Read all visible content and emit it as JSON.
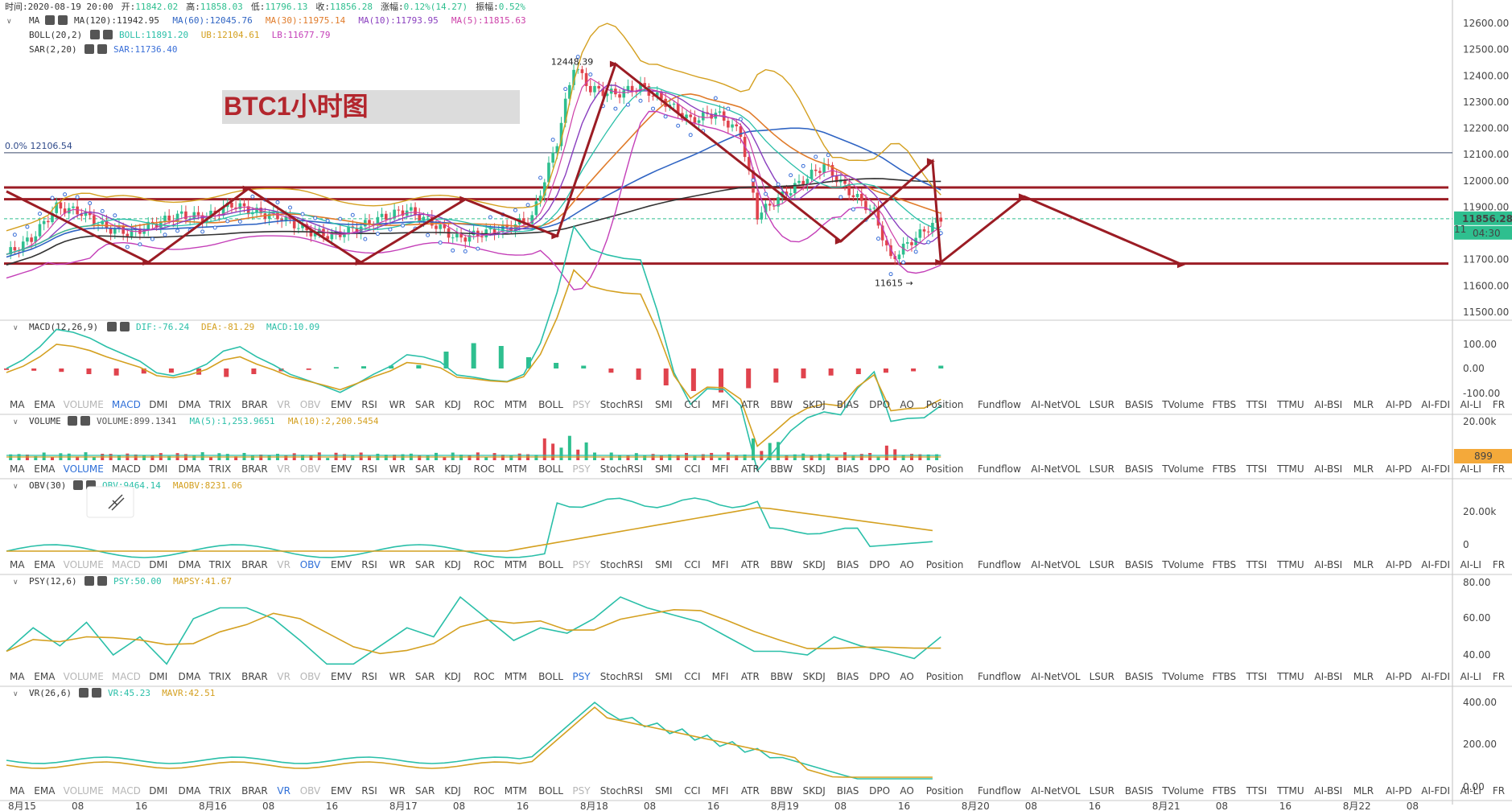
{
  "header": {
    "time_label": "时间:",
    "time": "2020-08-19 20:00",
    "open_label": "开:",
    "open": "11842.02",
    "high_label": "高:",
    "high": "11858.03",
    "low_label": "低:",
    "low": "11796.13",
    "close_label": "收:",
    "close": "11856.28",
    "change_label": "涨幅:",
    "change": "0.12%(14.27)",
    "amp_label": "振幅:",
    "amp": "0.52%"
  },
  "overlay_title": "BTC1小时图",
  "colors": {
    "bull": "#2ebf8f",
    "bear": "#e0434d",
    "annot": "#9b1c24",
    "ma120": "#333333",
    "ma60": "#2f64c3",
    "ma30": "#e07b2a",
    "ma10": "#8a3fbf",
    "ma5": "#cc3fa8",
    "boll": "#2abfa8",
    "ub": "#d4a020",
    "lb": "#c43fb8",
    "sar": "#3a6fd8"
  },
  "indicators": {
    "ma": {
      "name": "MA",
      "values": [
        {
          "label": "MA(120):11942.95",
          "color": "#333333"
        },
        {
          "label": "MA(60):12045.76",
          "color": "#2f64c3"
        },
        {
          "label": "MA(30):11975.14",
          "color": "#e07b2a"
        },
        {
          "label": "MA(10):11793.95",
          "color": "#8a3fbf"
        },
        {
          "label": "MA(5):11815.63",
          "color": "#cc3fa8"
        }
      ]
    },
    "boll": {
      "name": "BOLL(20,2)",
      "values": [
        {
          "label": "BOLL:11891.20",
          "color": "#2abfa8"
        },
        {
          "label": "UB:12104.61",
          "color": "#d4a020"
        },
        {
          "label": "LB:11677.79",
          "color": "#c43fb8"
        }
      ]
    },
    "sar": {
      "name": "SAR(2,20)",
      "values": [
        {
          "label": "SAR:11736.40",
          "color": "#3a6fd8"
        }
      ]
    }
  },
  "panels": [
    {
      "id": "macd",
      "name": "MACD(12,26,9)",
      "values": [
        {
          "label": "DIF:-76.24",
          "color": "#2abfa8"
        },
        {
          "label": "DEA:-81.29",
          "color": "#d4a020"
        },
        {
          "label": "MACD:10.09",
          "color": "#2abfa8"
        }
      ],
      "ticks": [
        "100.00",
        "0.00",
        "-100.00"
      ]
    },
    {
      "id": "volume",
      "name": "VOLUME",
      "values": [
        {
          "label": "VOLUME:899.1341",
          "color": "#555555"
        },
        {
          "label": "MA(5):1,253.9651",
          "color": "#2abfa8"
        },
        {
          "label": "MA(10):2,200.5454",
          "color": "#d4a020"
        }
      ],
      "ticks": [
        "20.00k"
      ],
      "badge": "899"
    },
    {
      "id": "obv",
      "name": "OBV(30)",
      "values": [
        {
          "label": "OBV:9464.14",
          "color": "#2abfa8"
        },
        {
          "label": "MAOBV:8231.06",
          "color": "#d4a020"
        }
      ],
      "ticks": [
        "20.00k",
        "0"
      ]
    },
    {
      "id": "psy",
      "name": "PSY(12,6)",
      "values": [
        {
          "label": "PSY:50.00",
          "color": "#2abfa8"
        },
        {
          "label": "MAPSY:41.67",
          "color": "#d4a020"
        }
      ],
      "ticks": [
        "80.00",
        "60.00",
        "40.00"
      ]
    },
    {
      "id": "vr",
      "name": "VR(26,6)",
      "values": [
        {
          "label": "VR:45.23",
          "color": "#2abfa8"
        },
        {
          "label": "MAVR:42.51",
          "color": "#d4a020"
        }
      ],
      "ticks": [
        "400.00",
        "200.00",
        "0.00"
      ]
    }
  ],
  "tab_bar": [
    "MA",
    "EMA",
    "VOLUME",
    "MACD",
    "DMI",
    "DMA",
    "TRIX",
    "BRAR",
    "VR",
    "OBV",
    "EMV",
    "RSI",
    "WR",
    "SAR",
    "KDJ",
    "ROC",
    "MTM",
    "BOLL",
    "PSY",
    "StochRSI",
    "SMI",
    "CCI",
    "MFI",
    "ATR",
    "BBW",
    "SKDJ",
    "BIAS",
    "DPO",
    "AO",
    "Position",
    "Fundflow",
    "AI-NetVOL",
    "LSUR",
    "BASIS",
    "TVolume",
    "FTBS",
    "TTSI",
    "TTMU",
    "AI-BSI",
    "MLR",
    "AI-PD",
    "AI-FDI",
    "AI-LI",
    "FR",
    "AI-BST"
  ],
  "tab_bars": [
    {
      "disabled": [
        "VOLUME",
        "VR",
        "OBV",
        "PSY"
      ],
      "active": "MACD"
    },
    {
      "disabled": [
        "VR",
        "OBV",
        "PSY"
      ],
      "active": "VOLUME"
    },
    {
      "disabled": [
        "VOLUME",
        "MACD",
        "VR",
        "PSY"
      ],
      "active": "OBV"
    },
    {
      "disabled": [
        "VOLUME",
        "MACD",
        "VR",
        "OBV"
      ],
      "active": "PSY"
    },
    {
      "disabled": [
        "VOLUME",
        "MACD",
        "OBV",
        "PSY"
      ],
      "active": "VR"
    }
  ],
  "time_axis": [
    "8月15",
    "08",
    "16",
    "8月16",
    "08",
    "16",
    "8月17",
    "08",
    "16",
    "8月18",
    "08",
    "16",
    "8月19",
    "08",
    "16",
    "8月20",
    "08",
    "16",
    "8月21",
    "08",
    "16",
    "8月22",
    "08"
  ],
  "price_axis": {
    "ticks": [
      "12600.00",
      "12500.00",
      "12400.00",
      "12300.00",
      "12200.00",
      "12100.00",
      "12000.00",
      "11900.00",
      "11800.00",
      "11700.00",
      "11600.00",
      "11500.00"
    ],
    "last_price": "11856.28",
    "countdown": "04:30",
    "hidden_value": "11"
  },
  "chart_data": {
    "type": "candlestick",
    "title": "BTC1小时图",
    "ylim": [
      11500,
      12650
    ],
    "annotations": {
      "fib_label": "0.0% 12106.54",
      "high_label": "12448.39",
      "low_label": "11615 →",
      "horizontal_levels": [
        11975,
        11930,
        11685,
        12107
      ]
    },
    "price_path": [
      {
        "t": 0,
        "o": 11700,
        "c": 11720
      },
      {
        "t": 6,
        "o": 11720,
        "c": 11780
      },
      {
        "t": 12,
        "o": 11780,
        "c": 11900
      },
      {
        "t": 18,
        "o": 11900,
        "c": 11880
      },
      {
        "t": 24,
        "o": 11880,
        "c": 11820
      },
      {
        "t": 30,
        "o": 11820,
        "c": 11800
      },
      {
        "t": 36,
        "o": 11800,
        "c": 11840
      },
      {
        "t": 42,
        "o": 11840,
        "c": 11870
      },
      {
        "t": 48,
        "o": 11870,
        "c": 11860
      },
      {
        "t": 54,
        "o": 11860,
        "c": 11910
      },
      {
        "t": 60,
        "o": 11910,
        "c": 11880
      },
      {
        "t": 66,
        "o": 11880,
        "c": 11860
      },
      {
        "t": 72,
        "o": 11860,
        "c": 11810
      },
      {
        "t": 78,
        "o": 11810,
        "c": 11790
      },
      {
        "t": 84,
        "o": 11790,
        "c": 11820
      },
      {
        "t": 90,
        "o": 11820,
        "c": 11860
      },
      {
        "t": 96,
        "o": 11860,
        "c": 11890
      },
      {
        "t": 102,
        "o": 11890,
        "c": 11840
      },
      {
        "t": 108,
        "o": 11840,
        "c": 11780
      },
      {
        "t": 114,
        "o": 11780,
        "c": 11800
      },
      {
        "t": 120,
        "o": 11800,
        "c": 11820
      },
      {
        "t": 126,
        "o": 11820,
        "c": 11860
      },
      {
        "t": 132,
        "o": 11860,
        "c": 12150
      },
      {
        "t": 136,
        "o": 12150,
        "c": 12440
      },
      {
        "t": 140,
        "o": 12440,
        "c": 12350
      },
      {
        "t": 146,
        "o": 12350,
        "c": 12330
      },
      {
        "t": 152,
        "o": 12330,
        "c": 12360
      },
      {
        "t": 158,
        "o": 12360,
        "c": 12300
      },
      {
        "t": 164,
        "o": 12300,
        "c": 12230
      },
      {
        "t": 170,
        "o": 12230,
        "c": 12260
      },
      {
        "t": 176,
        "o": 12260,
        "c": 12180
      },
      {
        "t": 180,
        "o": 12180,
        "c": 11870
      },
      {
        "t": 184,
        "o": 11870,
        "c": 11920
      },
      {
        "t": 190,
        "o": 11920,
        "c": 11990
      },
      {
        "t": 196,
        "o": 11990,
        "c": 12060
      },
      {
        "t": 202,
        "o": 12060,
        "c": 11960
      },
      {
        "t": 208,
        "o": 11960,
        "c": 11880
      },
      {
        "t": 212,
        "o": 11880,
        "c": 11700
      },
      {
        "t": 216,
        "o": 11700,
        "c": 11760
      },
      {
        "t": 220,
        "o": 11760,
        "c": 11810
      },
      {
        "t": 224,
        "o": 11810,
        "c": 11856
      }
    ],
    "macd_hist": [
      -5,
      -8,
      -12,
      -20,
      -25,
      -18,
      -15,
      -22,
      -30,
      -20,
      -10,
      -5,
      5,
      8,
      10,
      12,
      60,
      90,
      80,
      40,
      20,
      10,
      -15,
      -40,
      -60,
      -80,
      -85,
      -70,
      -50,
      -35,
      -25,
      -20,
      -15,
      -10,
      10
    ],
    "psy": [
      42,
      55,
      45,
      58,
      40,
      50,
      35,
      60,
      66,
      66,
      60,
      48,
      35,
      35,
      45,
      55,
      50,
      72,
      60,
      48,
      55,
      52,
      60,
      72,
      66,
      62,
      58,
      50,
      42,
      42,
      40,
      50,
      45,
      42,
      38,
      50
    ]
  }
}
